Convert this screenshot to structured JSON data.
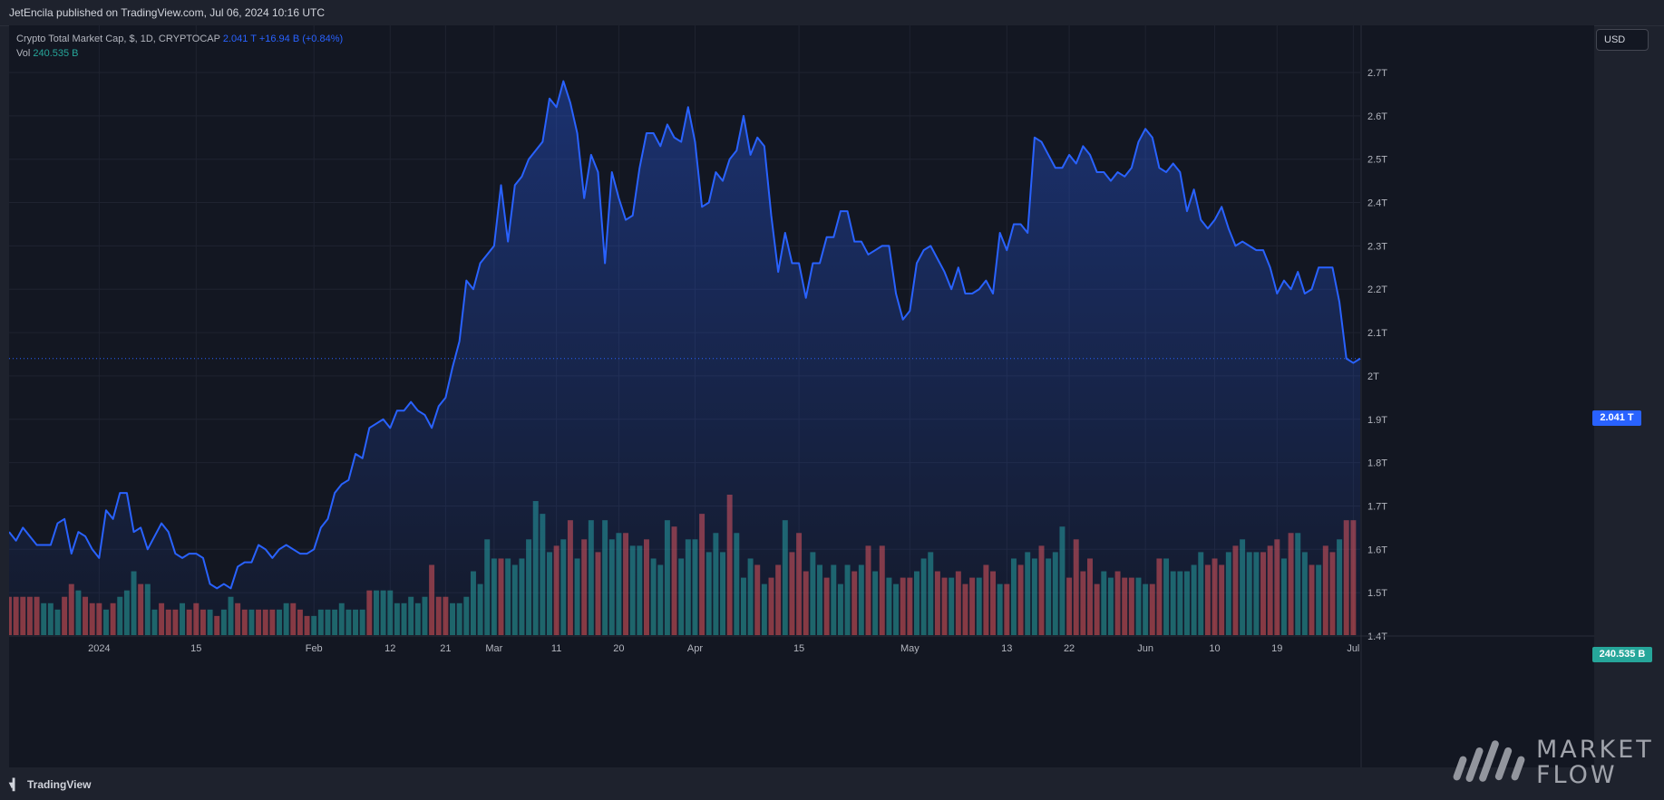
{
  "header": {
    "published_text": "JetEncila published on TradingView.com, Jul 06, 2024 10:16 UTC"
  },
  "legend": {
    "symbol": "Crypto Total Market Cap, $, 1D, CRYPTOCAP",
    "price": "2.041 T",
    "change": "+16.94 B (+0.84%)",
    "vol_label": "Vol",
    "vol_value": "240.535 B"
  },
  "currency_button": "USD",
  "price_badge": "2.041 T",
  "vol_badge": "240.535 B",
  "footer": {
    "brand": "TradingView"
  },
  "watermark": {
    "line1": "MARKET",
    "line2": "FLOW"
  },
  "colors": {
    "line": "#2962ff",
    "up": "#26a69a",
    "down": "#ef5350",
    "bg": "#131722"
  },
  "chart_data": {
    "type": "area",
    "y_axis": {
      "ticks": [
        "2.7T",
        "2.6T",
        "2.5T",
        "2.4T",
        "2.3T",
        "2.2T",
        "2.1T",
        "2T",
        "1.9T",
        "1.8T",
        "1.7T",
        "1.6T",
        "1.5T",
        "1.4T"
      ],
      "range": [
        1.4,
        2.7
      ],
      "unit": "T"
    },
    "x_axis": {
      "ticks": [
        "2024",
        "15",
        "Feb",
        "12",
        "21",
        "Mar",
        "11",
        "20",
        "Apr",
        "15",
        "May",
        "13",
        "22",
        "Jun",
        "10",
        "19",
        "Jul"
      ]
    },
    "series": [
      {
        "values": [
          1.64,
          1.62,
          1.65,
          1.63,
          1.61,
          1.61,
          1.61,
          1.66,
          1.67,
          1.59,
          1.64,
          1.63,
          1.6,
          1.58,
          1.69,
          1.67,
          1.73,
          1.73,
          1.64,
          1.65,
          1.6,
          1.63,
          1.66,
          1.64,
          1.59,
          1.58,
          1.59,
          1.59,
          1.58,
          1.52,
          1.51,
          1.52,
          1.51,
          1.56,
          1.57,
          1.57,
          1.61,
          1.6,
          1.58,
          1.6,
          1.61,
          1.6,
          1.59,
          1.59,
          1.6,
          1.65,
          1.67,
          1.73,
          1.75,
          1.76,
          1.82,
          1.81,
          1.88,
          1.89,
          1.9,
          1.88,
          1.92,
          1.92,
          1.94,
          1.92,
          1.91,
          1.88,
          1.93,
          1.95,
          2.02,
          2.08,
          2.22,
          2.2,
          2.26,
          2.28,
          2.3,
          2.44,
          2.31,
          2.44,
          2.46,
          2.5,
          2.52,
          2.54,
          2.64,
          2.62,
          2.68,
          2.63,
          2.56,
          2.41,
          2.51,
          2.47,
          2.26,
          2.47,
          2.41,
          2.36,
          2.37,
          2.48,
          2.56,
          2.56,
          2.53,
          2.58,
          2.55,
          2.54,
          2.62,
          2.54,
          2.39,
          2.4,
          2.47,
          2.45,
          2.5,
          2.52,
          2.6,
          2.51,
          2.55,
          2.53,
          2.37,
          2.24,
          2.33,
          2.26,
          2.26,
          2.18,
          2.26,
          2.26,
          2.32,
          2.32,
          2.38,
          2.38,
          2.31,
          2.31,
          2.28,
          2.29,
          2.3,
          2.3,
          2.19,
          2.13,
          2.15,
          2.26,
          2.29,
          2.3,
          2.27,
          2.24,
          2.2,
          2.25,
          2.19,
          2.19,
          2.2,
          2.22,
          2.19,
          2.33,
          2.29,
          2.35,
          2.35,
          2.33,
          2.55,
          2.54,
          2.51,
          2.48,
          2.48,
          2.51,
          2.49,
          2.53,
          2.51,
          2.47,
          2.47,
          2.45,
          2.47,
          2.46,
          2.48,
          2.54,
          2.57,
          2.55,
          2.48,
          2.47,
          2.49,
          2.47,
          2.38,
          2.43,
          2.36,
          2.34,
          2.36,
          2.39,
          2.34,
          2.3,
          2.31,
          2.3,
          2.29,
          2.29,
          2.25,
          2.19,
          2.22,
          2.2,
          2.24,
          2.19,
          2.2,
          2.25,
          2.25,
          2.25,
          2.17,
          2.04,
          2.03,
          2.04
        ]
      }
    ],
    "volume": {
      "values": [
        0.6,
        0.6,
        0.6,
        0.6,
        0.6,
        0.5,
        0.5,
        0.4,
        0.6,
        0.8,
        0.7,
        0.6,
        0.5,
        0.5,
        0.4,
        0.5,
        0.6,
        0.7,
        1,
        0.8,
        0.8,
        0.4,
        0.5,
        0.4,
        0.4,
        0.5,
        0.4,
        0.5,
        0.4,
        0.4,
        0.3,
        0.4,
        0.6,
        0.5,
        0.4,
        0.4,
        0.4,
        0.4,
        0.4,
        0.4,
        0.5,
        0.5,
        0.4,
        0.3,
        0.3,
        0.4,
        0.4,
        0.4,
        0.5,
        0.4,
        0.4,
        0.4,
        0.7,
        0.7,
        0.7,
        0.7,
        0.5,
        0.5,
        0.6,
        0.5,
        0.6,
        1.1,
        0.6,
        0.6,
        0.5,
        0.5,
        0.6,
        1,
        0.8,
        1.5,
        1.2,
        1.2,
        1.2,
        1.1,
        1.2,
        1.5,
        2.1,
        1.9,
        1.3,
        1.4,
        1.5,
        1.8,
        1.2,
        1.5,
        1.8,
        1.3,
        1.8,
        1.5,
        1.6,
        1.6,
        1.4,
        1.4,
        1.5,
        1.2,
        1.1,
        1.8,
        1.7,
        1.2,
        1.5,
        1.5,
        1.9,
        1.3,
        1.6,
        1.3,
        2.2,
        1.6,
        0.9,
        1.2,
        1.1,
        0.8,
        0.9,
        1.1,
        1.8,
        1.3,
        1.6,
        1,
        1.3,
        1.1,
        0.9,
        1.1,
        0.8,
        1.1,
        1,
        1.1,
        1.4,
        1,
        1.4,
        0.9,
        0.8,
        0.9,
        0.9,
        1,
        1.2,
        1.3,
        1,
        0.9,
        0.9,
        1,
        0.8,
        0.9,
        0.9,
        1.1,
        1,
        0.8,
        0.8,
        1.2,
        1.1,
        1.3,
        1.2,
        1.4,
        1.2,
        1.3,
        1.7,
        0.9,
        1.5,
        1,
        1.2,
        0.8,
        1,
        0.9,
        1,
        0.9,
        0.9,
        0.9,
        0.8,
        0.8,
        1.2,
        1.2,
        1,
        1,
        1,
        1.1,
        1.3,
        1.1,
        1.2,
        1.1,
        1.3,
        1.4,
        1.5,
        1.3,
        1.3,
        1.3,
        1.4,
        1.5,
        1.2,
        1.6,
        1.6,
        1.3,
        1.1,
        1.1,
        1.4,
        1.3,
        1.5,
        1.8,
        1.8
      ],
      "up_down": [
        "d",
        "d",
        "d",
        "d",
        "d",
        "u",
        "u",
        "u",
        "d",
        "d",
        "u",
        "d",
        "d",
        "d",
        "u",
        "d",
        "u",
        "u",
        "u",
        "d",
        "u",
        "u",
        "d",
        "d",
        "d",
        "u",
        "d",
        "d",
        "d",
        "u",
        "d",
        "u",
        "u",
        "d",
        "d",
        "u",
        "d",
        "d",
        "d",
        "u",
        "u",
        "d",
        "d",
        "d",
        "u",
        "u",
        "u",
        "u",
        "u",
        "u",
        "u",
        "u",
        "d",
        "u",
        "u",
        "u",
        "u",
        "u",
        "u",
        "u",
        "u",
        "d",
        "d",
        "d",
        "u",
        "u",
        "u",
        "u",
        "u",
        "u",
        "u",
        "d",
        "u",
        "u",
        "u",
        "u",
        "u",
        "u",
        "u",
        "d",
        "u",
        "d",
        "u",
        "d",
        "u",
        "d",
        "u",
        "u",
        "u",
        "d",
        "u",
        "u",
        "d",
        "u",
        "u",
        "u",
        "d",
        "u",
        "u",
        "u",
        "d",
        "u",
        "u",
        "u",
        "d",
        "u",
        "u",
        "u",
        "d",
        "u",
        "d",
        "d",
        "u",
        "d",
        "d",
        "d",
        "u",
        "u",
        "d",
        "u",
        "u",
        "u",
        "d",
        "u",
        "d",
        "u",
        "d",
        "u",
        "u",
        "d",
        "d",
        "u",
        "u",
        "u",
        "d",
        "d",
        "u",
        "d",
        "d",
        "d",
        "u",
        "d",
        "d",
        "u",
        "d",
        "u",
        "d",
        "u",
        "u",
        "d",
        "u",
        "u",
        "u",
        "d",
        "d",
        "d",
        "d",
        "d",
        "u",
        "u",
        "d",
        "d",
        "d",
        "u",
        "u",
        "d",
        "d",
        "u",
        "u",
        "u",
        "u",
        "u",
        "u",
        "d",
        "d",
        "d",
        "u",
        "d",
        "u",
        "u",
        "u",
        "d",
        "d",
        "d",
        "u",
        "d",
        "u",
        "u",
        "d",
        "u",
        "d",
        "d",
        "u",
        "d",
        "d",
        "d"
      ]
    }
  }
}
